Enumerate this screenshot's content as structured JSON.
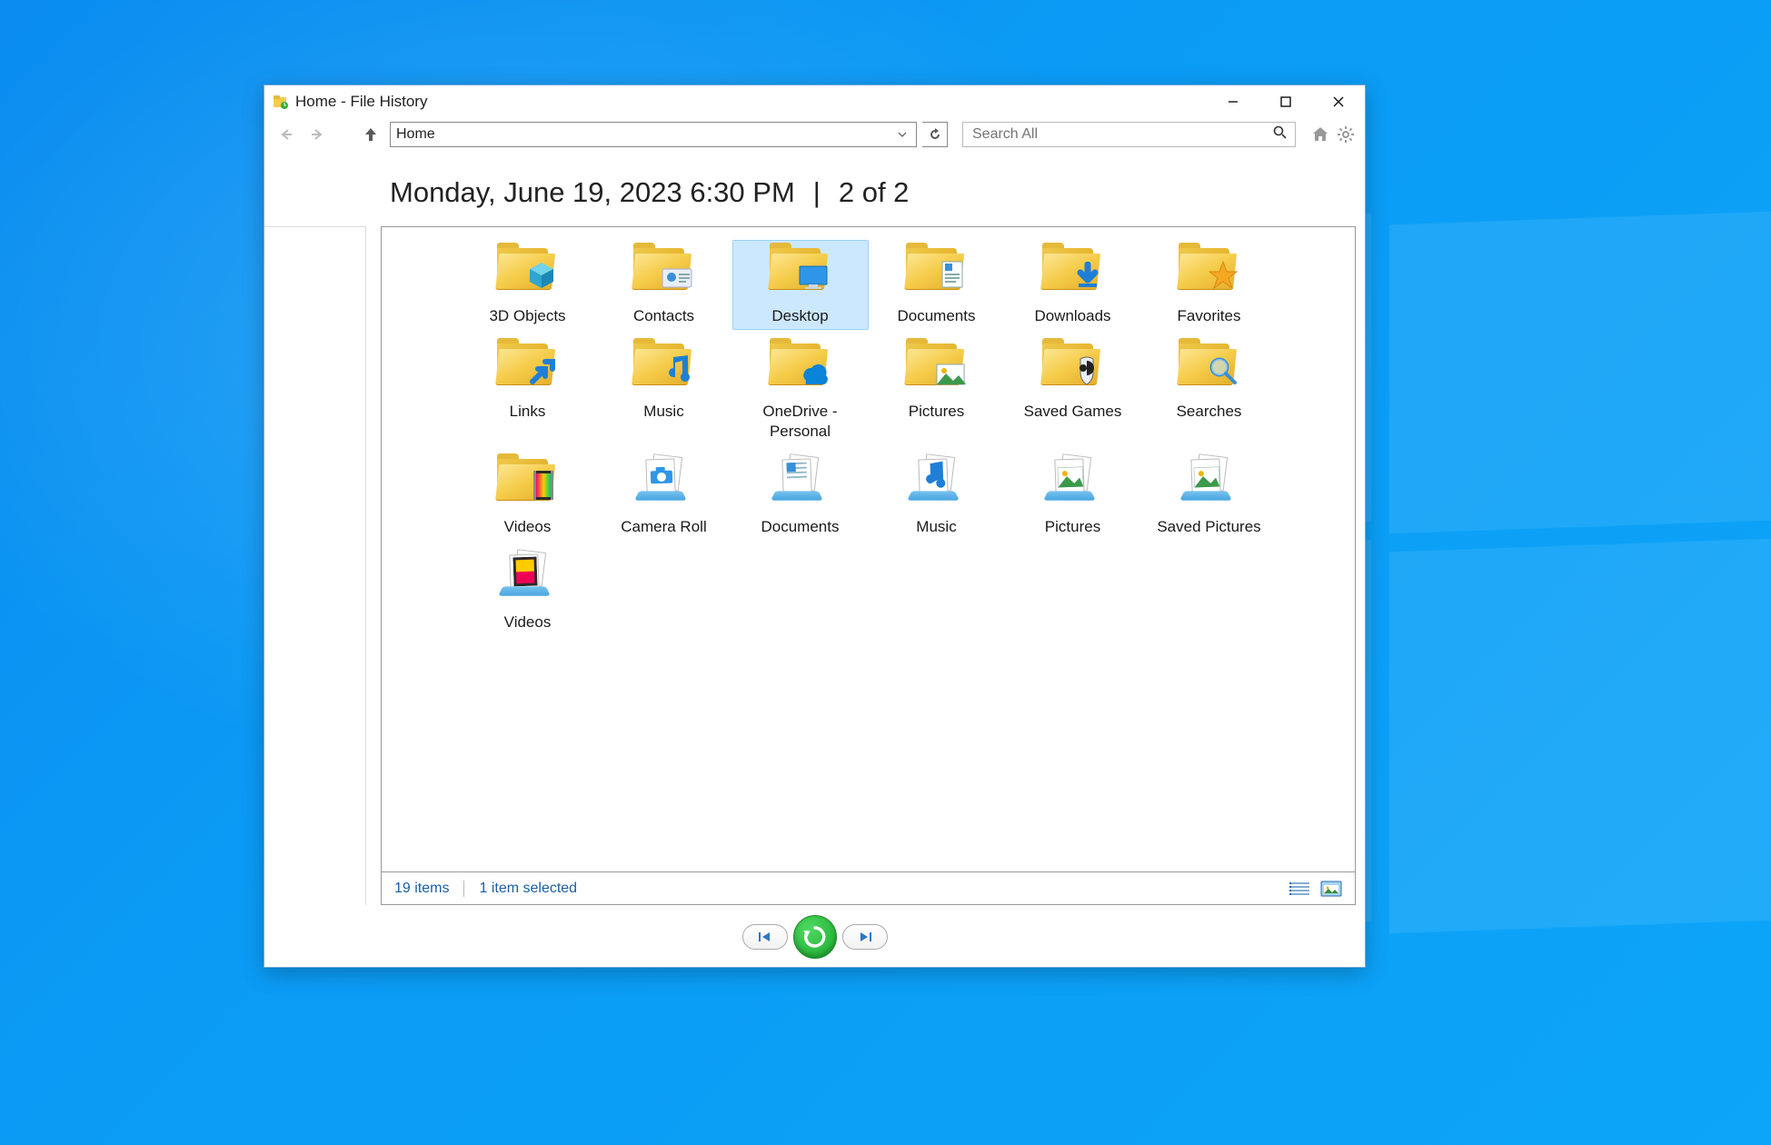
{
  "window": {
    "title": "Home - File History"
  },
  "nav": {
    "address": "Home",
    "searchPlaceholder": "Search All"
  },
  "snapshot": {
    "timestamp": "Monday, June 19, 2023 6:30 PM",
    "divider": "|",
    "position": "2 of 2"
  },
  "items": [
    {
      "name": "3D Objects",
      "icon": "folder-3dobjects",
      "type": "folder",
      "selected": false
    },
    {
      "name": "Contacts",
      "icon": "folder-contacts",
      "type": "folder",
      "selected": false
    },
    {
      "name": "Desktop",
      "icon": "folder-desktop",
      "type": "folder",
      "selected": true
    },
    {
      "name": "Documents",
      "icon": "folder-documents",
      "type": "folder",
      "selected": false
    },
    {
      "name": "Downloads",
      "icon": "folder-downloads",
      "type": "folder",
      "selected": false
    },
    {
      "name": "Favorites",
      "icon": "folder-favorites",
      "type": "folder",
      "selected": false
    },
    {
      "name": "Links",
      "icon": "folder-links",
      "type": "folder",
      "selected": false
    },
    {
      "name": "Music",
      "icon": "folder-music",
      "type": "folder",
      "selected": false
    },
    {
      "name": "OneDrive - Personal",
      "icon": "folder-onedrive",
      "type": "folder",
      "selected": false
    },
    {
      "name": "Pictures",
      "icon": "folder-pictures",
      "type": "folder",
      "selected": false
    },
    {
      "name": "Saved Games",
      "icon": "folder-savedgames",
      "type": "folder",
      "selected": false
    },
    {
      "name": "Searches",
      "icon": "folder-searches",
      "type": "folder",
      "selected": false
    },
    {
      "name": "Videos",
      "icon": "folder-videos",
      "type": "folder",
      "selected": false
    },
    {
      "name": "Camera Roll",
      "icon": "library-cameraroll",
      "type": "library",
      "selected": false
    },
    {
      "name": "Documents",
      "icon": "library-documents",
      "type": "library",
      "selected": false
    },
    {
      "name": "Music",
      "icon": "library-music",
      "type": "library",
      "selected": false
    },
    {
      "name": "Pictures",
      "icon": "library-pictures",
      "type": "library",
      "selected": false
    },
    {
      "name": "Saved Pictures",
      "icon": "library-savedpictures",
      "type": "library",
      "selected": false
    },
    {
      "name": "Videos",
      "icon": "library-videos",
      "type": "library",
      "selected": false
    }
  ],
  "status": {
    "count": "19 items",
    "selection": "1 item selected"
  }
}
